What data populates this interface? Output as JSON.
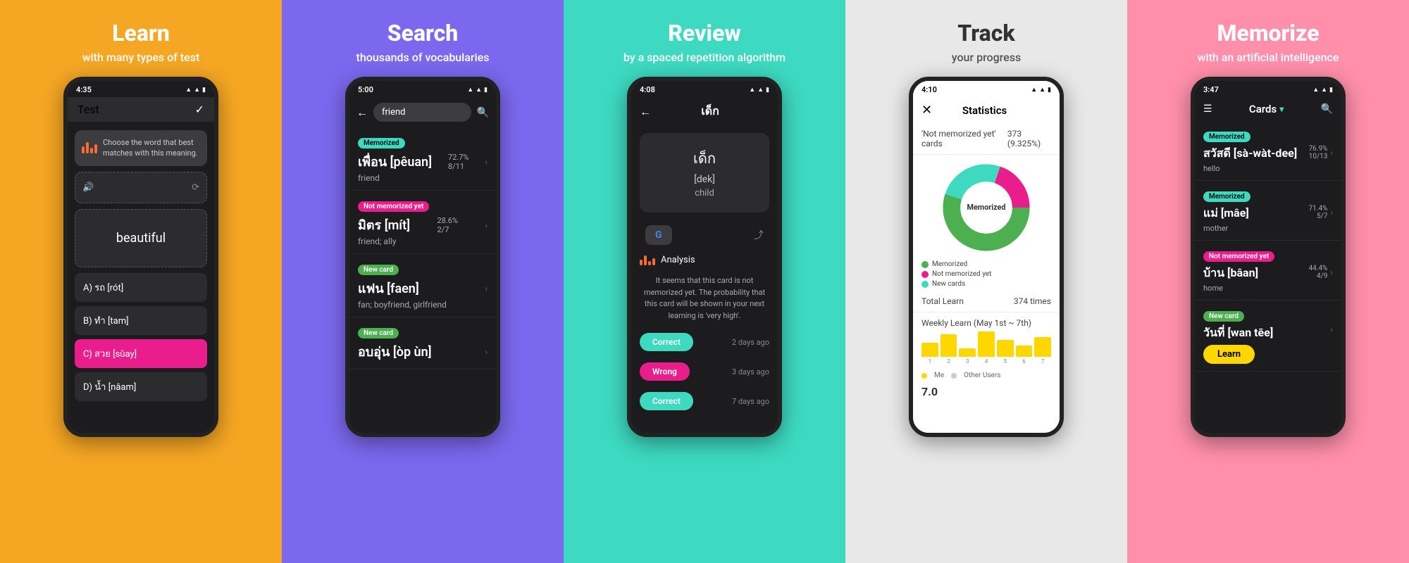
{
  "panels": [
    {
      "id": "learn",
      "bg": "#F5A623",
      "header_title": "Learn",
      "header_subtitle": "with many types of test",
      "phone_type": "dark",
      "status_time": "4:35",
      "screen": "test"
    },
    {
      "id": "search",
      "bg": "#7B68EE",
      "header_title": "Search",
      "header_subtitle": "thousands of vocabularies",
      "phone_type": "dark",
      "status_time": "5:00",
      "screen": "search"
    },
    {
      "id": "review",
      "bg": "#3DD9C0",
      "header_title": "Review",
      "header_subtitle": "by a spaced repetition algorithm",
      "phone_type": "dark",
      "status_time": "4:08",
      "screen": "review"
    },
    {
      "id": "track",
      "bg": "#EEEEEE",
      "header_title": "Track",
      "header_subtitle": "your progress",
      "phone_type": "light",
      "status_time": "4:10",
      "screen": "track"
    },
    {
      "id": "memorize",
      "bg": "#FF8FAB",
      "header_title": "Memorize",
      "header_subtitle": "with an artificial intelligence",
      "phone_type": "dark",
      "status_time": "3:47",
      "screen": "memo"
    }
  ],
  "test_screen": {
    "title": "Test",
    "instruction": "Choose the word that best matches with this meaning.",
    "answer_word": "beautiful",
    "choices": [
      {
        "label": "A) รถ [rót]",
        "highlighted": false
      },
      {
        "label": "B) ทำ [tam]",
        "highlighted": false
      },
      {
        "label": "C) สวย [sǔay]",
        "highlighted": true
      },
      {
        "label": "D) น้ำ [nâam]",
        "highlighted": false
      }
    ]
  },
  "search_screen": {
    "query": "friend",
    "results": [
      {
        "tag": "Memorized",
        "tag_type": "memorized",
        "word": "เพื่อน [pêuan]",
        "pct": "72.7%",
        "count": "8/11",
        "definition": "friend"
      },
      {
        "tag": "Not memorized yet",
        "tag_type": "not-memorized",
        "word": "มิตร [mít]",
        "pct": "28.6%",
        "count": "2/7",
        "definition": "friend; ally"
      },
      {
        "tag": "New card",
        "tag_type": "new",
        "word": "แฟน [faen]",
        "pct": "",
        "count": "",
        "definition": "fan; boyfriend, girlfriend"
      },
      {
        "tag": "New card",
        "tag_type": "new",
        "word": "อบอุ่น [òp ùn]",
        "pct": "",
        "count": "",
        "definition": ""
      }
    ]
  },
  "review_screen": {
    "word_thai": "เด็ก",
    "word_phonetic": "[dek]",
    "word_definition": "child",
    "analysis_label": "Analysis",
    "description": "It seems that this card is not memorized yet. The probability that this card will be shown in your next learning is 'very high'.",
    "history": [
      {
        "result": "Correct",
        "result_type": "correct",
        "time": "2 days ago"
      },
      {
        "result": "Wrong",
        "result_type": "wrong",
        "time": "3 days ago"
      },
      {
        "result": "Correct",
        "result_type": "correct",
        "time": "7 days ago"
      }
    ]
  },
  "track_screen": {
    "title": "Statistics",
    "not_memorized_label": "'Not memorized yet' cards",
    "not_memorized_value": "373 (9.325%)",
    "chart_segments": [
      {
        "label": "Memorized",
        "color": "#4CAF50",
        "percent": 55
      },
      {
        "label": "Not memorized yet",
        "color": "#e91e8c",
        "percent": 20
      },
      {
        "label": "New cards",
        "color": "#3DD9C0",
        "percent": 25
      }
    ],
    "total_learn_label": "Total Learn",
    "total_learn_value": "374 times",
    "weekly_label": "Weekly Learn (May 1st ~ 7th)",
    "bar_data": [
      5,
      8,
      3,
      9,
      6,
      4,
      7
    ],
    "bar_labels": [
      "1",
      "2",
      "3",
      "4",
      "5",
      "6",
      "7"
    ],
    "legend_me": "Me",
    "legend_others": "Other Users",
    "score": "7.0"
  },
  "memo_screen": {
    "cards_label": "Cards",
    "items": [
      {
        "tag": "Memorized",
        "tag_type": "memorized",
        "word": "สวัสดี [sà-wàt-dee]",
        "pct": "76.9%",
        "count": "10/13",
        "definition": "hello",
        "has_learn_btn": false
      },
      {
        "tag": "Memorized",
        "tag_type": "memorized",
        "word": "แม่ [mâe]",
        "pct": "71.4%",
        "count": "5/7",
        "definition": "mother",
        "has_learn_btn": false
      },
      {
        "tag": "Not memorized yet",
        "tag_type": "not-memorized",
        "word": "บ้าน [bâan]",
        "pct": "44.4%",
        "count": "4/9",
        "definition": "home",
        "has_learn_btn": false
      },
      {
        "tag": "New card",
        "tag_type": "new",
        "word": "วันที่ [wan tēe]",
        "pct": "",
        "count": "",
        "definition": "",
        "has_learn_btn": true
      }
    ],
    "learn_btn_label": "Learn"
  }
}
